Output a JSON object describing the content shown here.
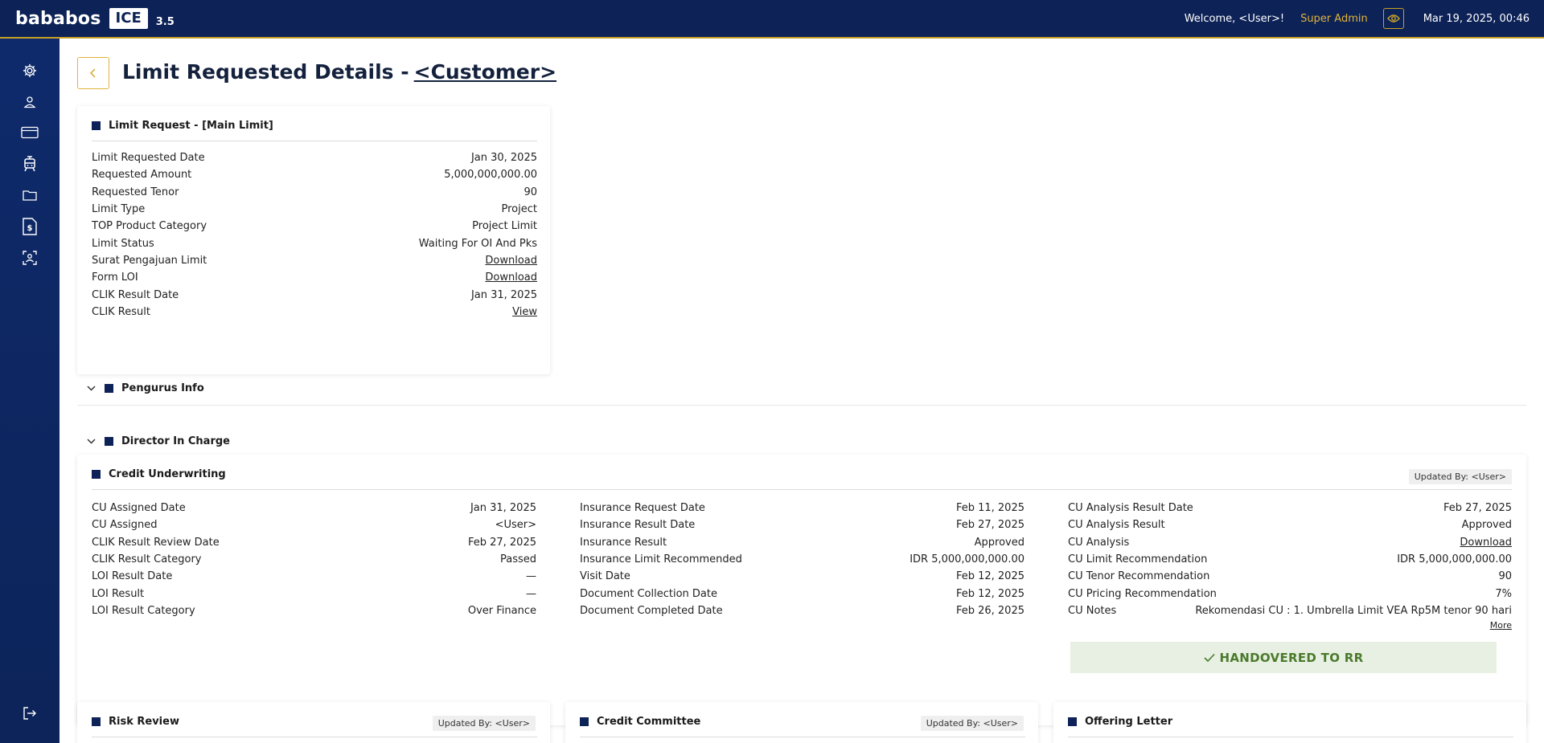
{
  "topbar": {
    "brand": "bababos",
    "badge": "ICE",
    "version": "3.5",
    "welcome": "Welcome, <User>!",
    "role": "Super Admin",
    "datetime": "Mar 19, 2025, 00:46",
    "accent_color": "#c9a227",
    "bg_color": "#0d2257"
  },
  "sidebar": {
    "icons": [
      "gear-icon",
      "user-icon",
      "card-icon",
      "tram-icon",
      "folder-icon",
      "dollar-document-icon",
      "face-scan-icon"
    ],
    "logout_icon": "logout-icon"
  },
  "page": {
    "title_prefix": "Limit Requested Details -",
    "title_customer": "<Customer>"
  },
  "limit_request": {
    "title": "Limit Request - [Main Limit]",
    "rows": [
      {
        "label": "Limit Requested Date",
        "value": "Jan 30, 2025"
      },
      {
        "label": "Requested Amount",
        "value": "5,000,000,000.00"
      },
      {
        "label": "Requested Tenor",
        "value": "90"
      },
      {
        "label": "Limit Type",
        "value": "Project"
      },
      {
        "label": "TOP Product Category",
        "value": "Project Limit"
      },
      {
        "label": "Limit Status",
        "value": "Waiting For OI And Pks"
      },
      {
        "label": "Surat Pengajuan Limit",
        "value": "Download"
      },
      {
        "label": "Form LOI",
        "value": "Download"
      },
      {
        "label": "CLIK Result Date",
        "value": "Jan 31, 2025"
      },
      {
        "label": "CLIK Result",
        "value": "View"
      }
    ]
  },
  "pengurus": {
    "title": "Pengurus Info"
  },
  "director": {
    "title": "Director In Charge"
  },
  "credit_underwriting": {
    "title": "Credit Underwriting",
    "updated_by": "Updated By: <User>",
    "col1": [
      {
        "label": "CU Assigned Date",
        "value": "Jan 31, 2025"
      },
      {
        "label": "CU Assigned",
        "value": "<User>"
      },
      {
        "label": "CLIK Result Review Date",
        "value": "Feb 27, 2025"
      },
      {
        "label": "CLIK Result Category",
        "value": "Passed"
      },
      {
        "label": "LOI Result Date",
        "value": "—"
      },
      {
        "label": "LOI Result",
        "value": "—"
      },
      {
        "label": "LOI Result Category",
        "value": "Over Finance"
      }
    ],
    "col2": [
      {
        "label": "Insurance Request Date",
        "value": "Feb 11, 2025"
      },
      {
        "label": "Insurance Result Date",
        "value": "Feb 27, 2025"
      },
      {
        "label": "Insurance Result",
        "value": "Approved"
      },
      {
        "label": "Insurance Limit Recommended",
        "value": "IDR 5,000,000,000.00"
      },
      {
        "label": "Visit Date",
        "value": "Feb 12, 2025"
      },
      {
        "label": "Document Collection Date",
        "value": "Feb 12, 2025"
      },
      {
        "label": "Document Completed Date",
        "value": "Feb 26, 2025"
      }
    ],
    "col3": [
      {
        "label": "CU Analysis Result Date",
        "value": "Feb 27, 2025"
      },
      {
        "label": "CU Analysis Result",
        "value": "Approved"
      },
      {
        "label": "CU Analysis",
        "value": "Download"
      },
      {
        "label": "CU Limit Recommendation",
        "value": "IDR 5,000,000,000.00"
      },
      {
        "label": "CU Tenor Recommendation",
        "value": "90"
      },
      {
        "label": "CU Pricing Recommendation",
        "value": "7%"
      },
      {
        "label": "CU Notes",
        "value": "Rekomendasi CU : 1. Umbrella Limit VEA Rp5M tenor 90 hari"
      }
    ],
    "more_label": "More",
    "handover_label": "HANDOVERED TO RR",
    "handover_color": "#4b7a2c"
  },
  "bottom_cards": {
    "risk_review": {
      "title": "Risk Review",
      "updated_by": "Updated By: <User>"
    },
    "credit_committee": {
      "title": "Credit Committee",
      "updated_by": "Updated By: <User>"
    },
    "offering_letter": {
      "title": "Offering Letter"
    }
  }
}
